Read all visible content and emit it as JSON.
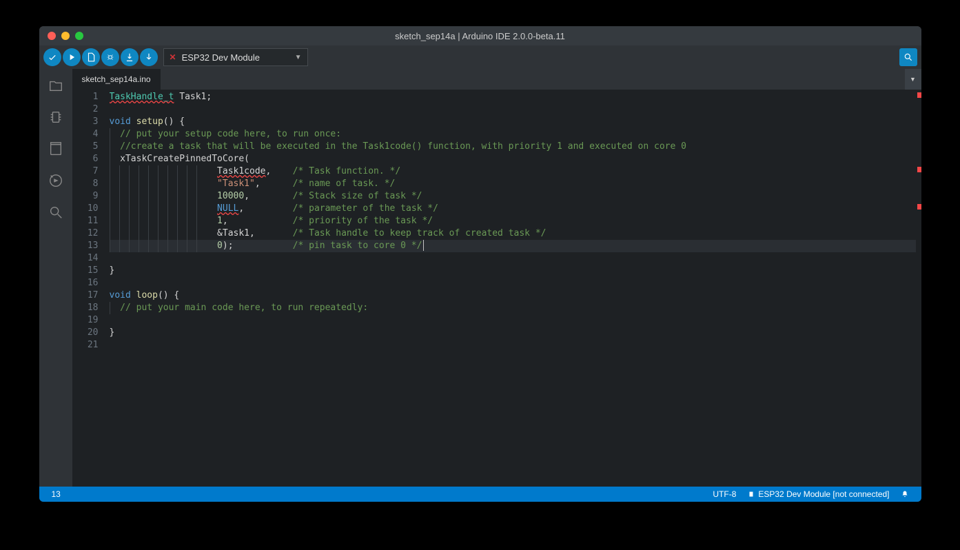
{
  "window": {
    "title": "sketch_sep14a | Arduino IDE 2.0.0-beta.11"
  },
  "toolbar": {
    "board": "ESP32 Dev Module"
  },
  "tabs": {
    "active": "sketch_sep14a.ino"
  },
  "code": {
    "lines": [
      {
        "n": 1,
        "tokens": [
          [
            "type",
            "TaskHandle_t",
            "err"
          ],
          [
            "ws",
            " "
          ],
          [
            "ident",
            "Task1"
          ],
          [
            "punct",
            ";"
          ]
        ]
      },
      {
        "n": 2,
        "tokens": []
      },
      {
        "n": 3,
        "tokens": [
          [
            "kw",
            "void"
          ],
          [
            "ws",
            " "
          ],
          [
            "fn",
            "setup"
          ],
          [
            "punct",
            "() {"
          ]
        ]
      },
      {
        "n": 4,
        "tokens": [
          [
            "indent",
            1
          ],
          [
            "comment",
            "// put your setup code here, to run once:"
          ]
        ]
      },
      {
        "n": 5,
        "tokens": [
          [
            "indent",
            1
          ],
          [
            "comment",
            "//create a task that will be executed in the Task1code() function, with priority 1 and executed on core 0"
          ]
        ]
      },
      {
        "n": 6,
        "tokens": [
          [
            "indent",
            1
          ],
          [
            "ident",
            "xTaskCreatePinnedToCore"
          ],
          [
            "punct",
            "("
          ]
        ]
      },
      {
        "n": 7,
        "tokens": [
          [
            "indent",
            10
          ],
          [
            "ident",
            "Task1code",
            "err"
          ],
          [
            "punct",
            ","
          ],
          [
            "pad",
            4
          ],
          [
            "comment",
            "/* Task function. */"
          ]
        ]
      },
      {
        "n": 8,
        "tokens": [
          [
            "indent",
            10
          ],
          [
            "str",
            "\"Task1\""
          ],
          [
            "punct",
            ","
          ],
          [
            "pad",
            6
          ],
          [
            "comment",
            "/* name of task. */"
          ]
        ]
      },
      {
        "n": 9,
        "tokens": [
          [
            "indent",
            10
          ],
          [
            "num",
            "10000"
          ],
          [
            "punct",
            ","
          ],
          [
            "pad",
            8
          ],
          [
            "comment",
            "/* Stack size of task */"
          ]
        ]
      },
      {
        "n": 10,
        "tokens": [
          [
            "indent",
            10
          ],
          [
            "null",
            "NULL",
            "err"
          ],
          [
            "punct",
            ","
          ],
          [
            "pad",
            9
          ],
          [
            "comment",
            "/* parameter of the task */"
          ]
        ]
      },
      {
        "n": 11,
        "tokens": [
          [
            "indent",
            10
          ],
          [
            "num",
            "1"
          ],
          [
            "punct",
            ","
          ],
          [
            "pad",
            12
          ],
          [
            "comment",
            "/* priority of the task */"
          ]
        ]
      },
      {
        "n": 12,
        "tokens": [
          [
            "indent",
            10
          ],
          [
            "punct",
            "&"
          ],
          [
            "ident",
            "Task1"
          ],
          [
            "punct",
            ","
          ],
          [
            "pad",
            7
          ],
          [
            "comment",
            "/* Task handle to keep track of created task */"
          ]
        ]
      },
      {
        "n": 13,
        "tokens": [
          [
            "indent",
            10
          ],
          [
            "num",
            "0"
          ],
          [
            "punct",
            ");"
          ],
          [
            "pad",
            11
          ],
          [
            "comment",
            "/* pin task to core 0 */"
          ],
          [
            "cursor"
          ]
        ],
        "active": true
      },
      {
        "n": 14,
        "tokens": []
      },
      {
        "n": 15,
        "tokens": [
          [
            "punct",
            "}"
          ]
        ]
      },
      {
        "n": 16,
        "tokens": []
      },
      {
        "n": 17,
        "tokens": [
          [
            "kw",
            "void"
          ],
          [
            "ws",
            " "
          ],
          [
            "fn",
            "loop"
          ],
          [
            "punct",
            "() {"
          ]
        ]
      },
      {
        "n": 18,
        "tokens": [
          [
            "indent",
            1
          ],
          [
            "comment",
            "// put your main code here, to run repeatedly:"
          ]
        ]
      },
      {
        "n": 19,
        "tokens": []
      },
      {
        "n": 20,
        "tokens": [
          [
            "punct",
            "}"
          ]
        ]
      },
      {
        "n": 21,
        "tokens": []
      }
    ],
    "error_markers": [
      1,
      7,
      10
    ]
  },
  "statusbar": {
    "line": "13",
    "encoding": "UTF-8",
    "board_status": "ESP32 Dev Module [not connected]"
  }
}
